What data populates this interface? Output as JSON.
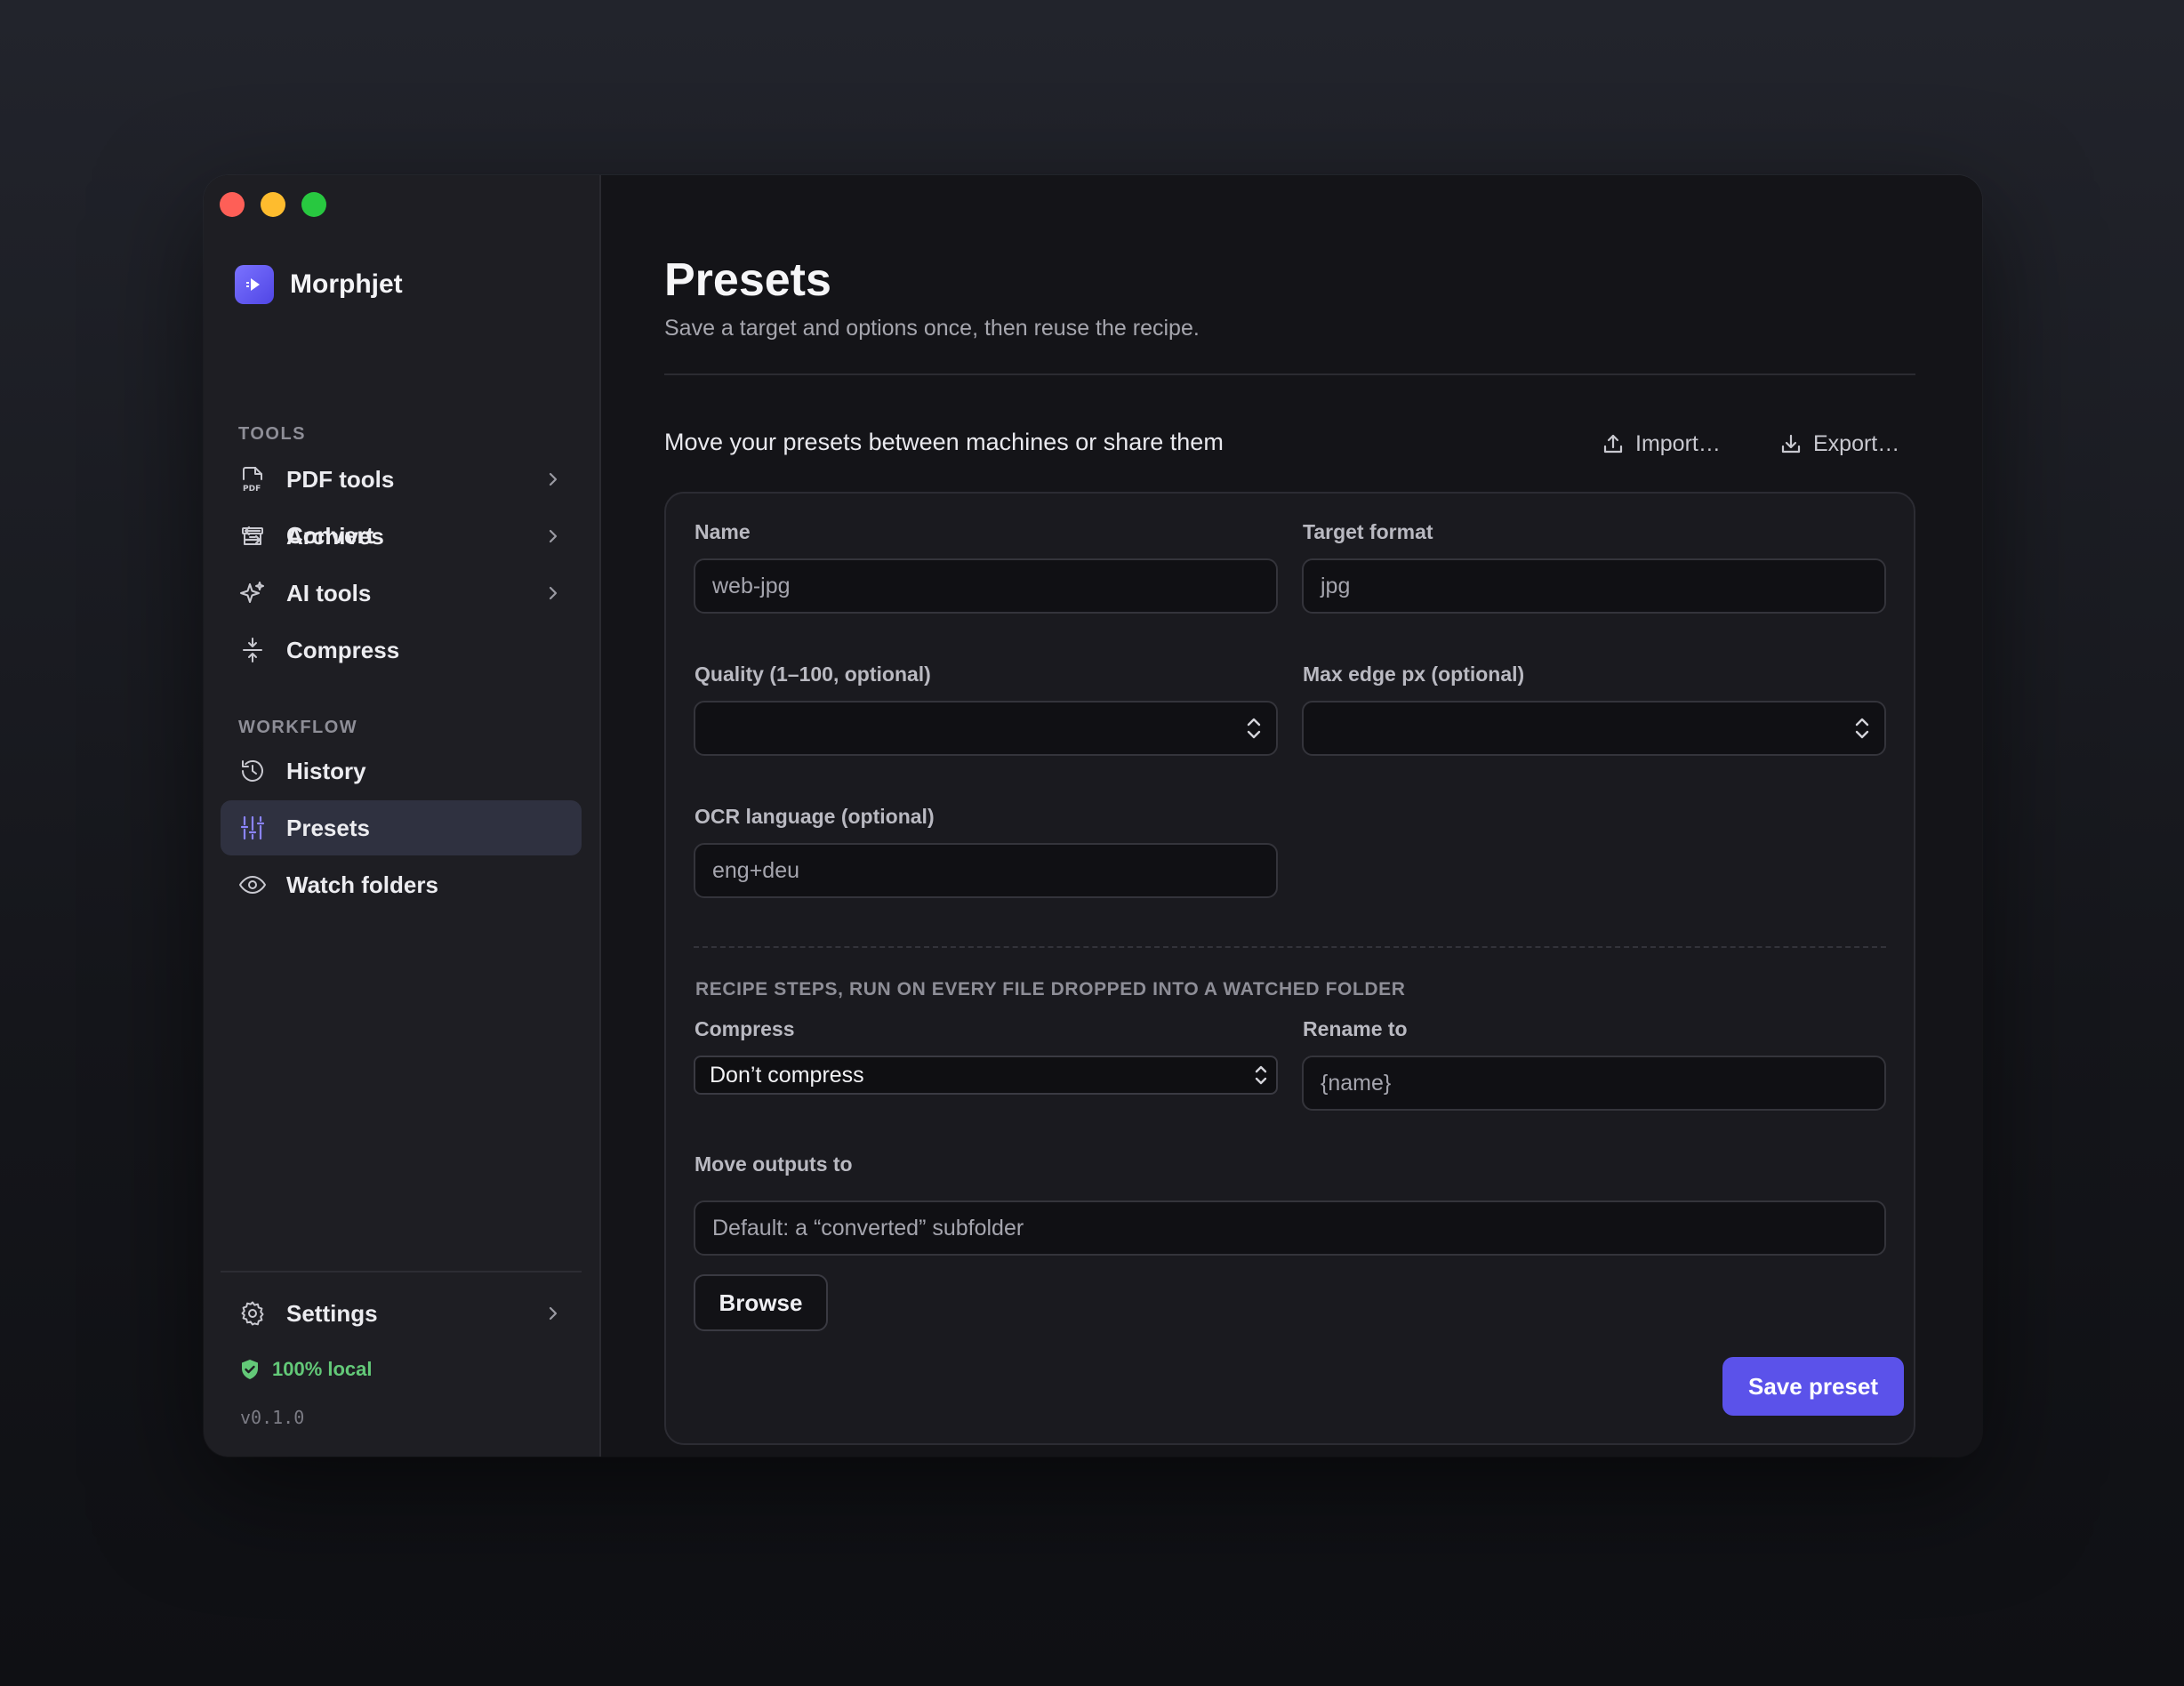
{
  "app": {
    "name": "Morphjet"
  },
  "sidebar": {
    "convert": "Convert",
    "tools_section": "TOOLS",
    "tools": [
      "PDF tools",
      "Archives",
      "AI tools",
      "Compress"
    ],
    "workflow_section": "WORKFLOW",
    "workflow": [
      "History",
      "Presets",
      "Watch folders"
    ],
    "active_item": "Presets",
    "settings": "Settings",
    "local_badge": "100% local",
    "version": "v0.1.0"
  },
  "icons": {
    "convert": "arrows-swap-icon",
    "pdf": "pdf-file-icon",
    "archives": "archive-box-icon",
    "ai": "sparkle-icon",
    "compress": "compress-icon",
    "history": "history-icon",
    "presets": "sliders-icon",
    "watch": "eye-icon",
    "settings": "gear-icon",
    "local": "shield-check-icon",
    "import": "upload-icon",
    "export": "download-icon"
  },
  "main": {
    "title": "Presets",
    "subtitle": "Save a target and options once, then reuse the recipe.",
    "share_text": "Move your presets between machines or share them",
    "import_label": "Import…",
    "export_label": "Export…"
  },
  "form": {
    "name_label": "Name",
    "name_placeholder": "web-jpg",
    "target_label": "Target format",
    "target_placeholder": "jpg",
    "quality_label": "Quality (1–100, optional)",
    "quality_value": "",
    "maxedge_label": "Max edge px (optional)",
    "maxedge_value": "",
    "ocr_label": "OCR language (optional)",
    "ocr_placeholder": "eng+deu",
    "recipe_label": "RECIPE STEPS, RUN ON EVERY FILE DROPPED INTO A WATCHED FOLDER",
    "compress_label": "Compress",
    "compress_value": "Don’t compress",
    "rename_label": "Rename to",
    "rename_placeholder": "{name}",
    "move_label": "Move outputs to",
    "move_placeholder": "Default: a “converted” subfolder",
    "browse_label": "Browse",
    "save_label": "Save preset"
  },
  "colors": {
    "accent": "#5b52ea",
    "accent_icon": "#8b84ff",
    "local_green": "#63c978",
    "sidebar_bg": "#1e1e23",
    "main_bg": "#141418"
  }
}
